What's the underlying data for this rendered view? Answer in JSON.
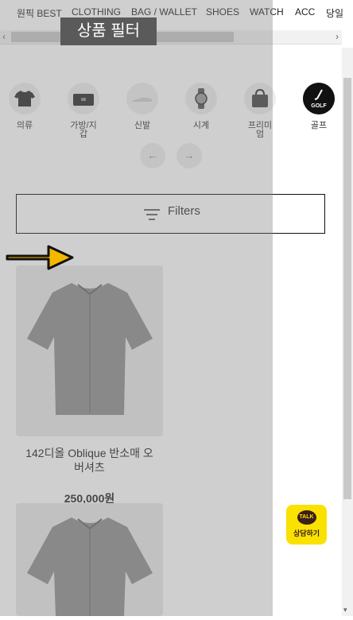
{
  "nav": {
    "items": [
      "원픽 BEST",
      "CLOTHING",
      "BAG / WALLET",
      "SHOES",
      "WATCH",
      "ACC",
      "당일"
    ]
  },
  "filter_title": "상품 필터",
  "categories": [
    {
      "label": "의류",
      "icon": "tshirt-icon"
    },
    {
      "label": "가방/지\n갑",
      "icon": "bag-icon"
    },
    {
      "label": "신발",
      "icon": "shoe-icon"
    },
    {
      "label": "시계",
      "icon": "watch-icon"
    },
    {
      "label": "프리미\n엄",
      "icon": "premium-bag-icon"
    },
    {
      "label": "골프",
      "icon": "golf-icon",
      "badge": "GOLF"
    }
  ],
  "filters": {
    "label": "Filters"
  },
  "products": [
    {
      "name": "142디올 Oblique 반소매 오\n버셔츠",
      "price": "250,000원"
    }
  ],
  "talk": {
    "badge": "TALK",
    "label": "상담하기"
  },
  "colors": {
    "kakao": "#fae100",
    "arrow": "#f5b800",
    "overlay": "#828282"
  }
}
